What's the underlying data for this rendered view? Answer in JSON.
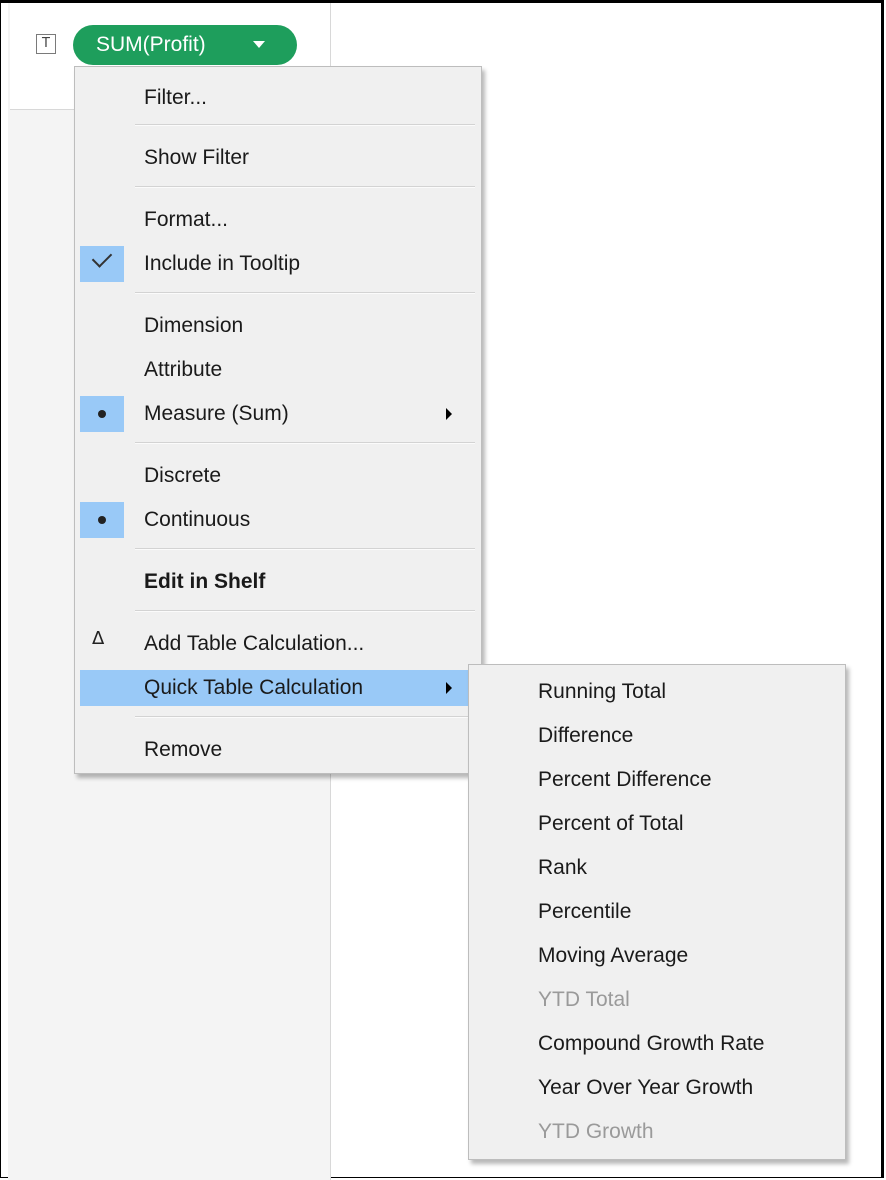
{
  "shelf": {
    "mark_type_icon": "text-mark-icon",
    "mark_type_glyph": "T",
    "pill_label": "SUM(Profit)",
    "pill_color": "#1e9e5c"
  },
  "context_menu": {
    "highlight_color": "#99c9f7",
    "items": [
      {
        "label": "Filter..."
      },
      {
        "label": "Show Filter"
      },
      {
        "label": "Format..."
      },
      {
        "label": "Include in Tooltip",
        "checked": true
      },
      {
        "label": "Dimension"
      },
      {
        "label": "Attribute"
      },
      {
        "label": "Measure (Sum)",
        "selected": true,
        "submenu": true
      },
      {
        "label": "Discrete"
      },
      {
        "label": "Continuous",
        "selected": true
      },
      {
        "label": "Edit in Shelf",
        "bold": true
      },
      {
        "label": "Add Table Calculation...",
        "icon": "delta-icon",
        "glyph": "Δ"
      },
      {
        "label": "Quick Table Calculation",
        "submenu": true,
        "highlighted": true
      },
      {
        "label": "Remove"
      }
    ]
  },
  "submenu": {
    "items": [
      {
        "label": "Running Total"
      },
      {
        "label": "Difference"
      },
      {
        "label": "Percent Difference"
      },
      {
        "label": "Percent of Total"
      },
      {
        "label": "Rank"
      },
      {
        "label": "Percentile"
      },
      {
        "label": "Moving Average"
      },
      {
        "label": "YTD Total",
        "disabled": true
      },
      {
        "label": "Compound Growth Rate"
      },
      {
        "label": "Year Over Year Growth"
      },
      {
        "label": "YTD Growth",
        "disabled": true
      }
    ]
  }
}
